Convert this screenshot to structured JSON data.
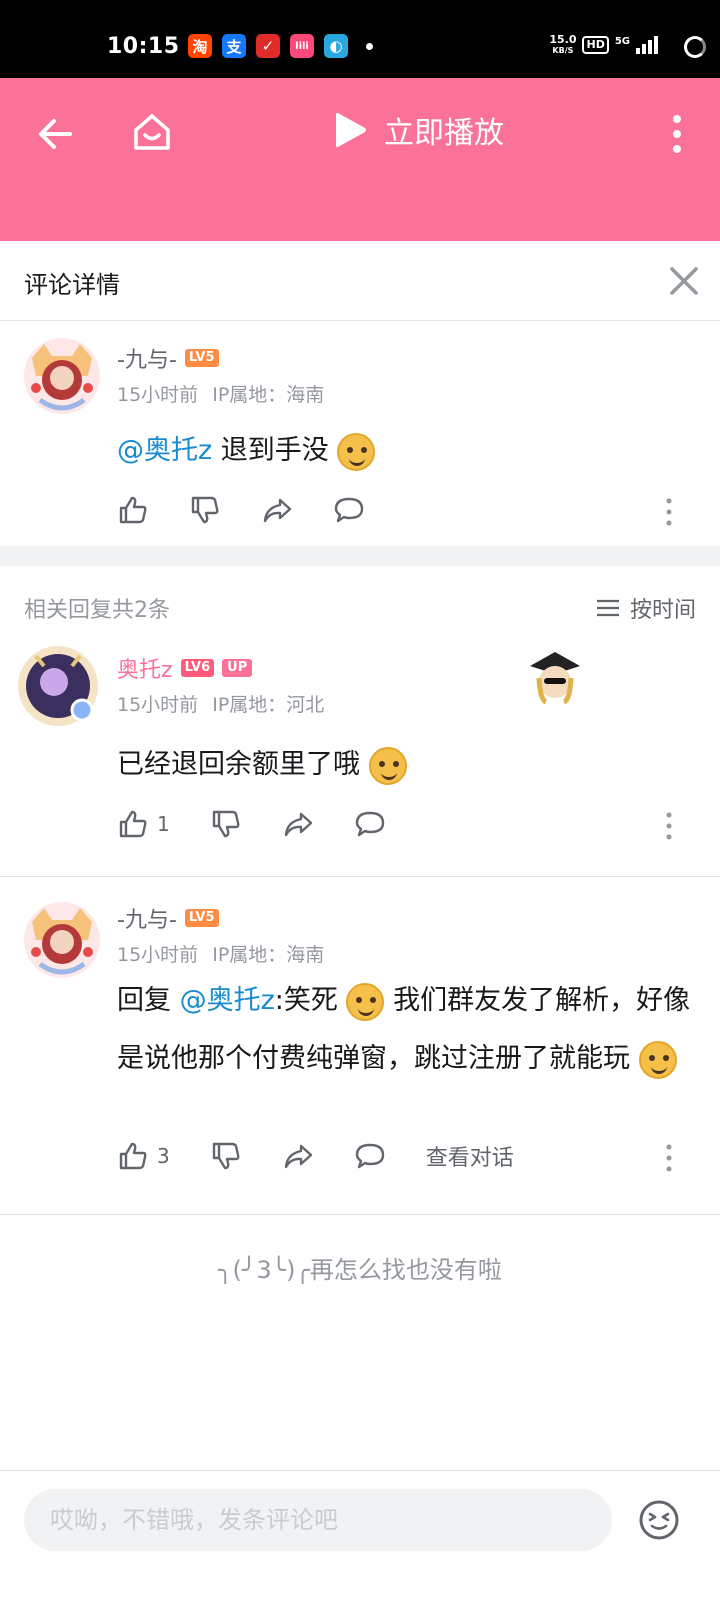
{
  "status_bar": {
    "time": "10:15",
    "apps": [
      {
        "name": "taobao-icon",
        "glyph": "淘",
        "color": "#ff4400"
      },
      {
        "name": "alipay-icon",
        "glyph": "支",
        "color": "#1677ff"
      },
      {
        "name": "app-red-icon",
        "glyph": "✓",
        "color": "#e02b2b"
      },
      {
        "name": "app-pink-icon",
        "glyph": "lili",
        "color": "#fb4a7a"
      },
      {
        "name": "browser-icon",
        "glyph": "◐",
        "color": "#2aa9e0"
      }
    ],
    "net_speed_value": "15.0",
    "net_speed_unit": "KB/S",
    "hd": "HD",
    "network": "5G"
  },
  "header": {
    "play_label": "立即播放"
  },
  "panel": {
    "title": "评论详情"
  },
  "main_comment": {
    "username": "-九与-",
    "level": "LV5",
    "time": "15小时前",
    "ip": "IP属地：海南",
    "mention": "@奥托z",
    "text": "退到手没"
  },
  "replies": {
    "count_label": "相关回复共2条",
    "sort_label": "按时间",
    "items": [
      {
        "username": "奥托z",
        "level": "LV6",
        "badge": "UP",
        "time": "15小时前",
        "ip": "IP属地：河北",
        "text": "已经退回余额里了哦",
        "likes": "1"
      },
      {
        "username": "-九与-",
        "level": "LV5",
        "time": "15小时前",
        "ip": "IP属地：海南",
        "reply_prefix": "回复",
        "mention": "@奥托z",
        "text_part1": ":笑死",
        "text_part2": "我们群友发了解析，好像是说他那个付费纯弹窗，跳过注册了就能玩",
        "likes": "3",
        "view_conversation": "查看对话"
      }
    ]
  },
  "end_message": "╮(╯3╰)╭再怎么找也没有啦",
  "composer": {
    "placeholder": "哎呦，不错哦，发条评论吧"
  },
  "colors": {
    "brand_pink": "#fb7299",
    "link_blue": "#178bcf"
  }
}
